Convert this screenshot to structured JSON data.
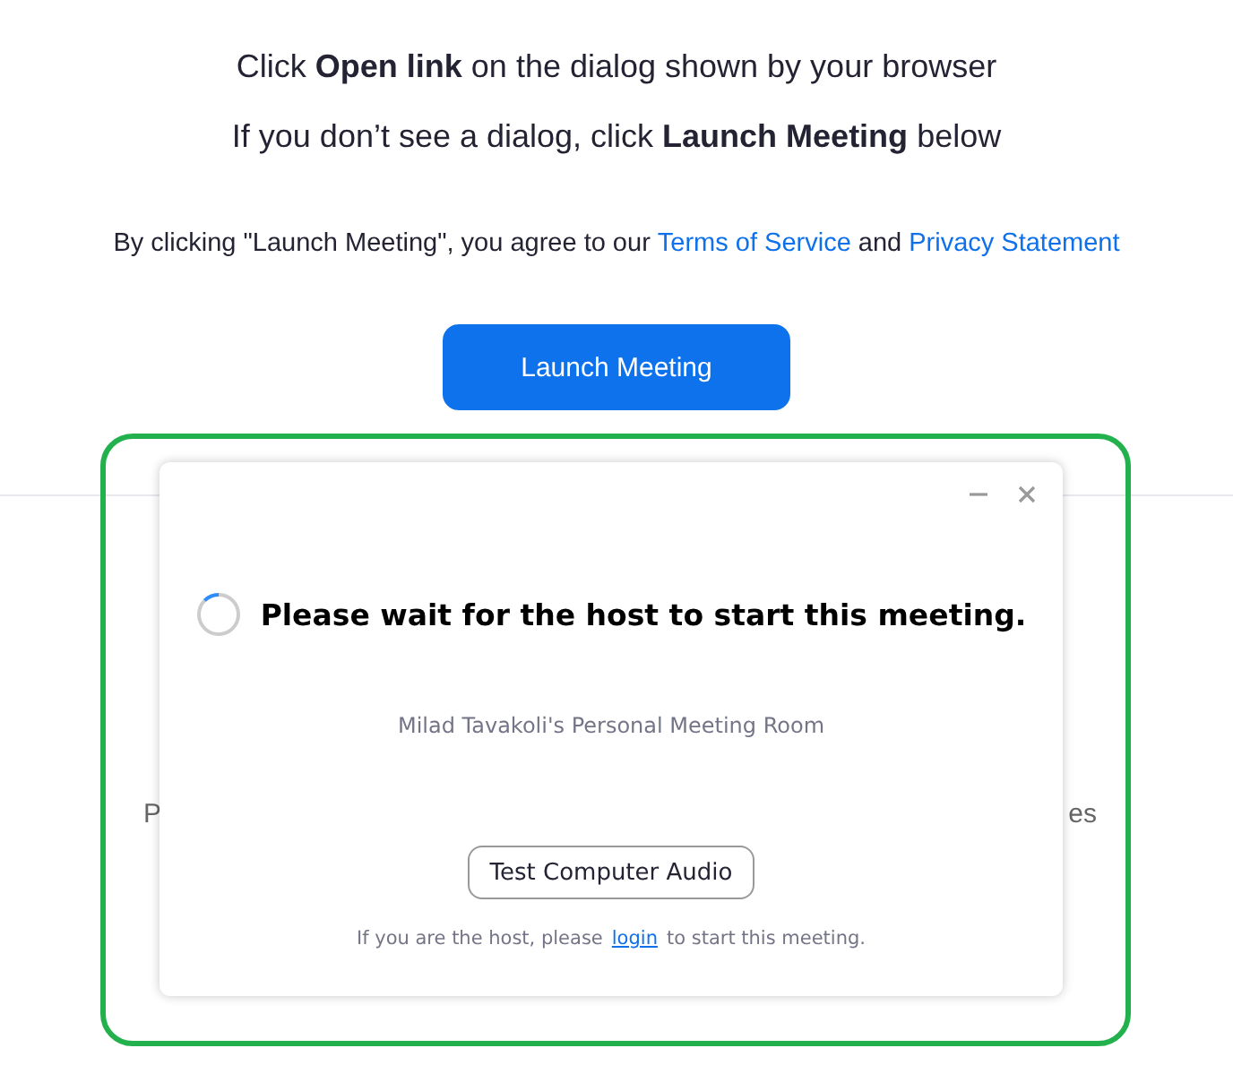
{
  "instructions": [
    "Click **Open link** on the dialog shown by your browser",
    "If you don’t see a dialog, click **Launch Meeting** below"
  ],
  "consent": {
    "text": "By clicking \"Launch Meeting\", you agree to our",
    "terms_link": "Terms of Service",
    "joiner": "and",
    "privacy_link": "Privacy Statement"
  },
  "launch_button": "Launch Meeting",
  "background_fragments": [
    "P",
    "es"
  ],
  "dialog": {
    "message": "Please wait for the host to start this meeting.",
    "room": "Milad Tavakoli's Personal Meeting Room",
    "test_button": "Test Computer Audio",
    "host_note": {
      "before": "If you are the host, please",
      "link": "login",
      "after": "to start this meeting."
    }
  }
}
